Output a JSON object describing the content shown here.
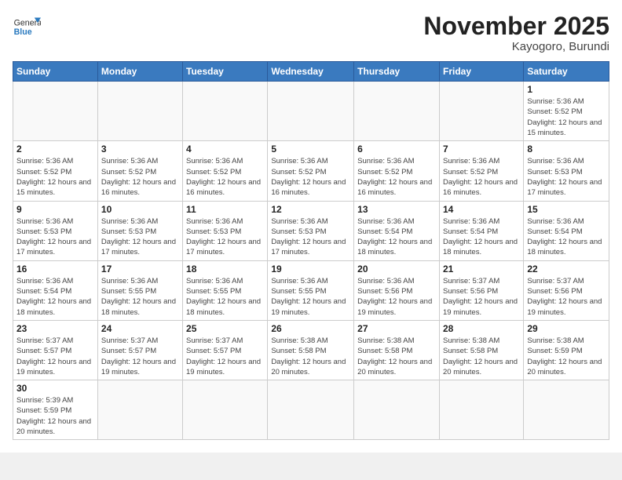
{
  "logo": {
    "general": "General",
    "blue": "Blue"
  },
  "header": {
    "month": "November 2025",
    "location": "Kayogoro, Burundi"
  },
  "weekdays": [
    "Sunday",
    "Monday",
    "Tuesday",
    "Wednesday",
    "Thursday",
    "Friday",
    "Saturday"
  ],
  "weeks": [
    [
      {
        "day": null,
        "info": null
      },
      {
        "day": null,
        "info": null
      },
      {
        "day": null,
        "info": null
      },
      {
        "day": null,
        "info": null
      },
      {
        "day": null,
        "info": null
      },
      {
        "day": null,
        "info": null
      },
      {
        "day": "1",
        "info": "Sunrise: 5:36 AM\nSunset: 5:52 PM\nDaylight: 12 hours and 15 minutes."
      }
    ],
    [
      {
        "day": "2",
        "info": "Sunrise: 5:36 AM\nSunset: 5:52 PM\nDaylight: 12 hours and 15 minutes."
      },
      {
        "day": "3",
        "info": "Sunrise: 5:36 AM\nSunset: 5:52 PM\nDaylight: 12 hours and 16 minutes."
      },
      {
        "day": "4",
        "info": "Sunrise: 5:36 AM\nSunset: 5:52 PM\nDaylight: 12 hours and 16 minutes."
      },
      {
        "day": "5",
        "info": "Sunrise: 5:36 AM\nSunset: 5:52 PM\nDaylight: 12 hours and 16 minutes."
      },
      {
        "day": "6",
        "info": "Sunrise: 5:36 AM\nSunset: 5:52 PM\nDaylight: 12 hours and 16 minutes."
      },
      {
        "day": "7",
        "info": "Sunrise: 5:36 AM\nSunset: 5:52 PM\nDaylight: 12 hours and 16 minutes."
      },
      {
        "day": "8",
        "info": "Sunrise: 5:36 AM\nSunset: 5:53 PM\nDaylight: 12 hours and 17 minutes."
      }
    ],
    [
      {
        "day": "9",
        "info": "Sunrise: 5:36 AM\nSunset: 5:53 PM\nDaylight: 12 hours and 17 minutes."
      },
      {
        "day": "10",
        "info": "Sunrise: 5:36 AM\nSunset: 5:53 PM\nDaylight: 12 hours and 17 minutes."
      },
      {
        "day": "11",
        "info": "Sunrise: 5:36 AM\nSunset: 5:53 PM\nDaylight: 12 hours and 17 minutes."
      },
      {
        "day": "12",
        "info": "Sunrise: 5:36 AM\nSunset: 5:53 PM\nDaylight: 12 hours and 17 minutes."
      },
      {
        "day": "13",
        "info": "Sunrise: 5:36 AM\nSunset: 5:54 PM\nDaylight: 12 hours and 18 minutes."
      },
      {
        "day": "14",
        "info": "Sunrise: 5:36 AM\nSunset: 5:54 PM\nDaylight: 12 hours and 18 minutes."
      },
      {
        "day": "15",
        "info": "Sunrise: 5:36 AM\nSunset: 5:54 PM\nDaylight: 12 hours and 18 minutes."
      }
    ],
    [
      {
        "day": "16",
        "info": "Sunrise: 5:36 AM\nSunset: 5:54 PM\nDaylight: 12 hours and 18 minutes."
      },
      {
        "day": "17",
        "info": "Sunrise: 5:36 AM\nSunset: 5:55 PM\nDaylight: 12 hours and 18 minutes."
      },
      {
        "day": "18",
        "info": "Sunrise: 5:36 AM\nSunset: 5:55 PM\nDaylight: 12 hours and 18 minutes."
      },
      {
        "day": "19",
        "info": "Sunrise: 5:36 AM\nSunset: 5:55 PM\nDaylight: 12 hours and 19 minutes."
      },
      {
        "day": "20",
        "info": "Sunrise: 5:36 AM\nSunset: 5:56 PM\nDaylight: 12 hours and 19 minutes."
      },
      {
        "day": "21",
        "info": "Sunrise: 5:37 AM\nSunset: 5:56 PM\nDaylight: 12 hours and 19 minutes."
      },
      {
        "day": "22",
        "info": "Sunrise: 5:37 AM\nSunset: 5:56 PM\nDaylight: 12 hours and 19 minutes."
      }
    ],
    [
      {
        "day": "23",
        "info": "Sunrise: 5:37 AM\nSunset: 5:57 PM\nDaylight: 12 hours and 19 minutes."
      },
      {
        "day": "24",
        "info": "Sunrise: 5:37 AM\nSunset: 5:57 PM\nDaylight: 12 hours and 19 minutes."
      },
      {
        "day": "25",
        "info": "Sunrise: 5:37 AM\nSunset: 5:57 PM\nDaylight: 12 hours and 19 minutes."
      },
      {
        "day": "26",
        "info": "Sunrise: 5:38 AM\nSunset: 5:58 PM\nDaylight: 12 hours and 20 minutes."
      },
      {
        "day": "27",
        "info": "Sunrise: 5:38 AM\nSunset: 5:58 PM\nDaylight: 12 hours and 20 minutes."
      },
      {
        "day": "28",
        "info": "Sunrise: 5:38 AM\nSunset: 5:58 PM\nDaylight: 12 hours and 20 minutes."
      },
      {
        "day": "29",
        "info": "Sunrise: 5:38 AM\nSunset: 5:59 PM\nDaylight: 12 hours and 20 minutes."
      }
    ],
    [
      {
        "day": "30",
        "info": "Sunrise: 5:39 AM\nSunset: 5:59 PM\nDaylight: 12 hours and 20 minutes."
      },
      {
        "day": null,
        "info": null
      },
      {
        "day": null,
        "info": null
      },
      {
        "day": null,
        "info": null
      },
      {
        "day": null,
        "info": null
      },
      {
        "day": null,
        "info": null
      },
      {
        "day": null,
        "info": null
      }
    ]
  ]
}
